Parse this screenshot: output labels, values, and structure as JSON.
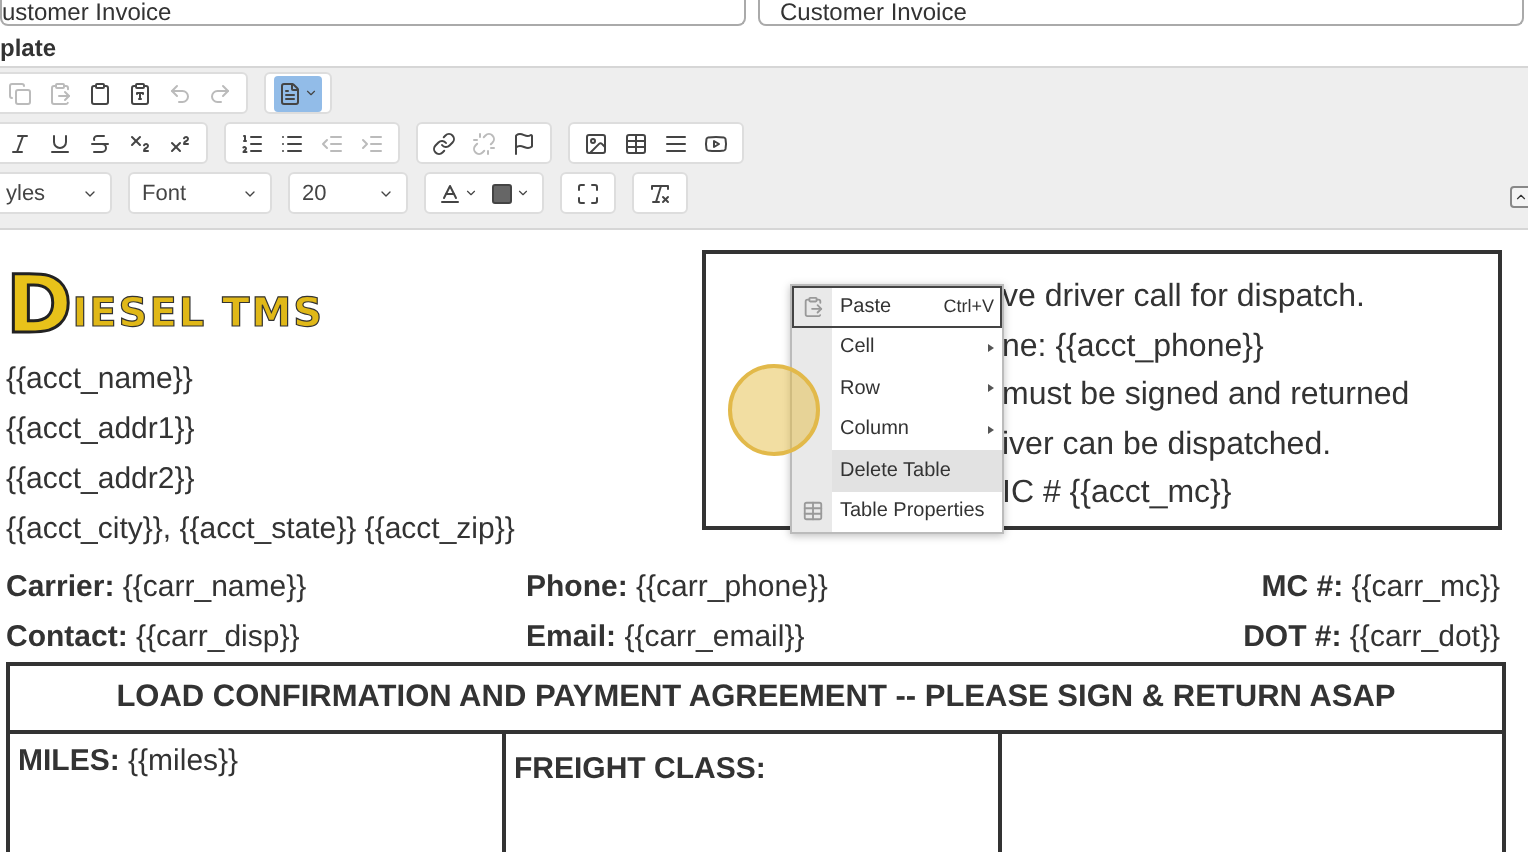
{
  "header_fields": [
    {
      "value": "ustomer Invoice"
    },
    {
      "value": "Customer Invoice"
    }
  ],
  "section_label": "plate",
  "toolbar": {
    "rows": [
      [
        {
          "buttons": [
            {
              "disabled": true
            },
            {
              "disabled": true
            },
            {
              "disabled": false
            },
            {
              "disabled": false
            },
            {
              "disabled": true
            },
            {
              "disabled": true
            }
          ]
        },
        {
          "buttons": [
            {
              "disabled": false,
              "selected": true
            }
          ]
        }
      ],
      [
        {
          "buttons": [
            {
              "disabled": false
            },
            {
              "disabled": false
            },
            {
              "disabled": false
            },
            {
              "disabled": false
            },
            {
              "disabled": false
            }
          ]
        },
        {
          "buttons": [
            {
              "disabled": false
            },
            {
              "disabled": false
            },
            {
              "disabled": true
            },
            {
              "disabled": true
            }
          ]
        },
        {
          "buttons": [
            {
              "disabled": false
            },
            {
              "disabled": true
            },
            {
              "disabled": false
            }
          ]
        },
        {
          "buttons": [
            {
              "disabled": false
            },
            {
              "disabled": false
            },
            {
              "disabled": false
            },
            {
              "disabled": false
            }
          ]
        }
      ]
    ],
    "dropdowns": [
      {
        "value": "yles"
      },
      {
        "value": "Font"
      },
      {
        "value": "20"
      }
    ]
  },
  "logo": {
    "mark": "D",
    "wordmark": "IESEL TMS"
  },
  "address_lines": [
    "{{acct_name}}",
    "{{acct_addr1}}",
    "{{acct_addr2}}",
    "{{acct_city}}, {{acct_state}} {{acct_zip}}"
  ],
  "notice_lines": [
    "ve driver call for dispatch.",
    "ne: {{acct_phone}}",
    "must be signed and returned",
    "iver can be dispatched.",
    "IC # {{acct_mc}}"
  ],
  "context_menu": [
    {
      "label": "Paste",
      "shortcut": "Ctrl+V",
      "kind": "icon",
      "focused": true,
      "selected": false
    },
    {
      "label": "Cell",
      "kind": "submenu",
      "focused": false,
      "selected": false
    },
    {
      "label": "Row",
      "kind": "submenu",
      "focused": false,
      "selected": false
    },
    {
      "label": "Column",
      "kind": "submenu",
      "focused": false,
      "selected": false
    },
    {
      "label": "Delete Table",
      "kind": "plain",
      "focused": false,
      "selected": true
    },
    {
      "label": "Table Properties",
      "kind": "table",
      "focused": false,
      "selected": false
    }
  ],
  "carrier_rows": [
    [
      {
        "label": "Carrier:",
        "value": "{{carr_name}}"
      },
      {
        "label": "Phone:",
        "value": "{{carr_phone}}"
      },
      {
        "label": "MC #:",
        "value": "{{carr_mc}}"
      }
    ],
    [
      {
        "label": "Contact:",
        "value": "{{carr_disp}}"
      },
      {
        "label": "Email:",
        "value": "{{carr_email}}"
      },
      {
        "label": "DOT #:",
        "value": "{{carr_dot}}"
      }
    ]
  ],
  "agreement_table": {
    "title": "LOAD CONFIRMATION AND PAYMENT AGREEMENT -- PLEASE SIGN & RETURN ASAP",
    "cells": [
      {
        "label": "MILES:",
        "value": "{{miles}}"
      },
      {
        "label": "FREIGHT CLASS:"
      },
      {}
    ]
  }
}
